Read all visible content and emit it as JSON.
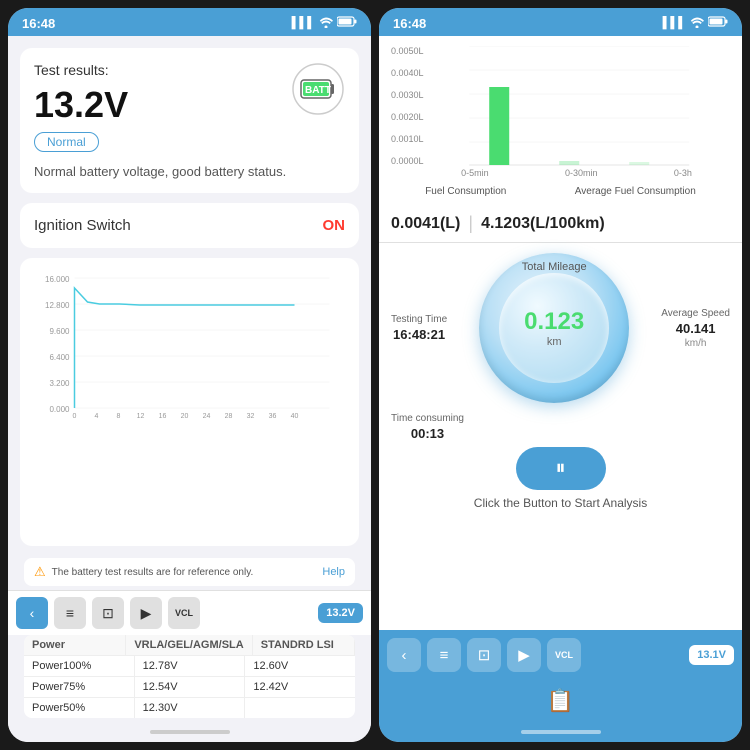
{
  "left_phone": {
    "status_bar": {
      "time": "16:48",
      "signal": "▌▌▌",
      "wifi": "wifi",
      "battery": "battery"
    },
    "test_results": {
      "title": "Test results:",
      "voltage": "13.2V",
      "badge": "Normal",
      "description": "Normal battery voltage, good battery status."
    },
    "ignition": {
      "label": "Ignition Switch",
      "status": "ON"
    },
    "chart": {
      "y_labels": [
        "16.000",
        "12.800",
        "9.600",
        "6.400",
        "3.200",
        "0.000"
      ],
      "x_labels": [
        "0",
        "4",
        "8",
        "12",
        "16",
        "20",
        "24",
        "28",
        "32",
        "36",
        "40"
      ]
    },
    "info_bar": {
      "text": "The battery test results are for reference only.",
      "help": "Help"
    },
    "toolbar": {
      "back": "‹",
      "filter": "⊟",
      "crop": "⊡",
      "play": "▶",
      "vcl": "VCL",
      "badge": "13.2V"
    },
    "table": {
      "headers": [
        "Power",
        "VRLA/GEL/AGM/SLA",
        "STANDRD LSI"
      ],
      "rows": [
        [
          "Power100%",
          "12.78V",
          "12.60V"
        ],
        [
          "Power75%",
          "12.54V",
          "12.42V"
        ],
        [
          "Power50%",
          "12.30V",
          ""
        ]
      ]
    }
  },
  "right_phone": {
    "status_bar": {
      "time": "16:48"
    },
    "fuel_chart": {
      "y_labels": [
        "0.0050L",
        "0.0040L",
        "0.0030L",
        "0.0020L",
        "0.0010L",
        "0.0000L"
      ],
      "x_labels": [
        "0-5min",
        "0-30min",
        "0-3h"
      ],
      "bar_labels": [
        "Fuel Consumption",
        "Average Fuel Consumption"
      ]
    },
    "fuel_values": {
      "consumption": "0.0041(L)",
      "avg_consumption": "4.1203(L/100km)"
    },
    "speedometer": {
      "title": "Total Mileage",
      "value": "0.123",
      "unit": "km"
    },
    "stats": {
      "testing_time_label": "Testing Time",
      "testing_time_value": "16:48:21",
      "time_consuming_label": "Time consuming",
      "time_consuming_value": "00:13",
      "average_speed_label": "Average Speed",
      "average_speed_value": "40.141",
      "average_speed_unit": "km/h"
    },
    "controls": {
      "pause_icon": "⏸",
      "start_analysis": "Click the Button to Start Analysis"
    },
    "toolbar": {
      "back": "‹",
      "filter": "⊟",
      "crop": "⊡",
      "play": "▶",
      "vcl": "VCL",
      "badge": "13.1V"
    },
    "footer": {
      "icon": "📋"
    }
  }
}
